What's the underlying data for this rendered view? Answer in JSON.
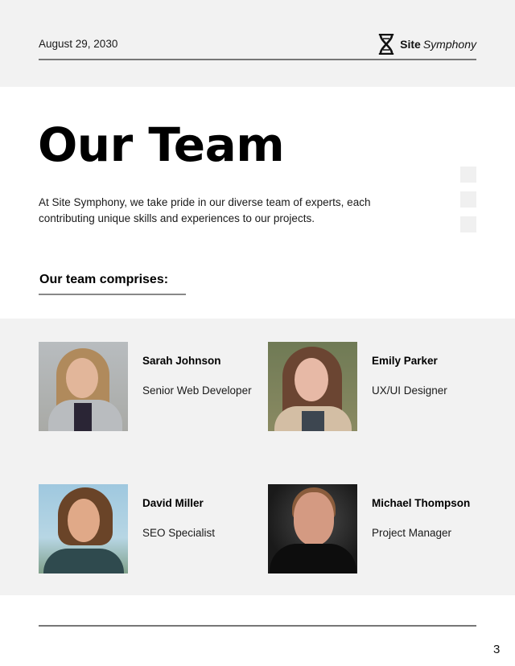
{
  "header": {
    "date": "August 29, 2030",
    "brand": {
      "icon": "dna-icon",
      "name_bold": "Site",
      "name_italic": "Symphony"
    }
  },
  "main": {
    "title": "Our Team",
    "intro": "At Site Symphony, we take pride in our diverse team of experts, each contributing unique skills and experiences to our projects.",
    "subtitle": "Our team comprises:"
  },
  "team": [
    {
      "name": "Sarah Johnson",
      "role": "Senior Web Developer",
      "photo": "photo-sarah-johnson"
    },
    {
      "name": "Emily Parker",
      "role": "UX/UI Designer",
      "photo": "photo-emily-parker"
    },
    {
      "name": "David Miller",
      "role": "SEO Specialist",
      "photo": "photo-david-miller"
    },
    {
      "name": "Michael Thompson",
      "role": "Project Manager",
      "photo": "photo-michael-thompson"
    }
  ],
  "footer": {
    "page_number": "3"
  },
  "colors": {
    "panel_bg": "#f2f2f2",
    "rule": "#777777",
    "text": "#000000"
  }
}
